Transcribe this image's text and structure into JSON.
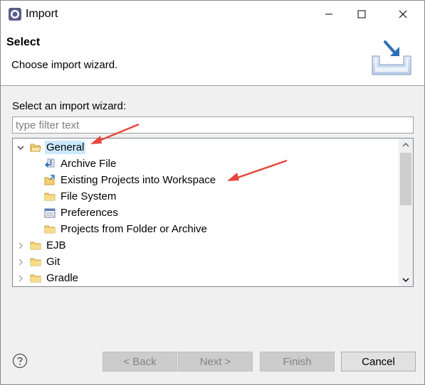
{
  "window": {
    "title": "Import"
  },
  "header": {
    "title": "Select",
    "description": "Choose import wizard."
  },
  "filter": {
    "label": "Select an import wizard:",
    "placeholder": "type filter text",
    "value": ""
  },
  "tree": {
    "items": [
      {
        "label": "General",
        "level": 0,
        "expanded": true,
        "icon": "folder-open-icon",
        "selected": true
      },
      {
        "label": "Archive File",
        "level": 1,
        "icon": "archive-file-icon"
      },
      {
        "label": "Existing Projects into Workspace",
        "level": 1,
        "icon": "existing-projects-icon"
      },
      {
        "label": "File System",
        "level": 1,
        "icon": "folder-icon"
      },
      {
        "label": "Preferences",
        "level": 1,
        "icon": "preferences-icon"
      },
      {
        "label": "Projects from Folder or Archive",
        "level": 1,
        "icon": "folder-icon"
      },
      {
        "label": "EJB",
        "level": 0,
        "expanded": false,
        "icon": "folder-icon"
      },
      {
        "label": "Git",
        "level": 0,
        "expanded": false,
        "icon": "folder-icon"
      },
      {
        "label": "Gradle",
        "level": 0,
        "expanded": false,
        "icon": "folder-icon"
      }
    ]
  },
  "buttons": {
    "back": "< Back",
    "next": "Next >",
    "finish": "Finish",
    "cancel": "Cancel"
  },
  "colors": {
    "annotation_arrow": "#e8453c",
    "selection": "#cce8ff",
    "folder": "#e8b84a"
  }
}
